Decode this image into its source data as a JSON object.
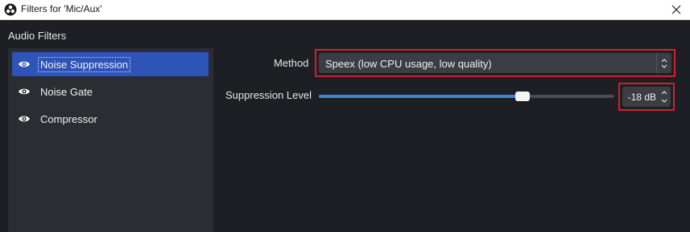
{
  "window": {
    "title": "Filters for 'Mic/Aux'",
    "app_icon": "obs-logo-icon",
    "close_icon": "close-icon"
  },
  "filters": {
    "section_title": "Audio Filters",
    "items": [
      {
        "label": "Noise Suppression",
        "icon": "eye-icon",
        "selected": true
      },
      {
        "label": "Noise Gate",
        "icon": "eye-icon",
        "selected": false
      },
      {
        "label": "Compressor",
        "icon": "eye-icon",
        "selected": false
      }
    ]
  },
  "properties": {
    "method": {
      "label": "Method",
      "value": "Speex (low CPU usage, low quality)"
    },
    "suppression_level": {
      "label": "Suppression Level",
      "value_text": "-18 dB",
      "slider_fraction": 0.69
    }
  },
  "colors": {
    "accent": "#2f54b8",
    "slider_fill": "#3d84d6",
    "highlight_border": "#d0202e",
    "background": "#1e1f24",
    "panel": "#2b2d33"
  }
}
